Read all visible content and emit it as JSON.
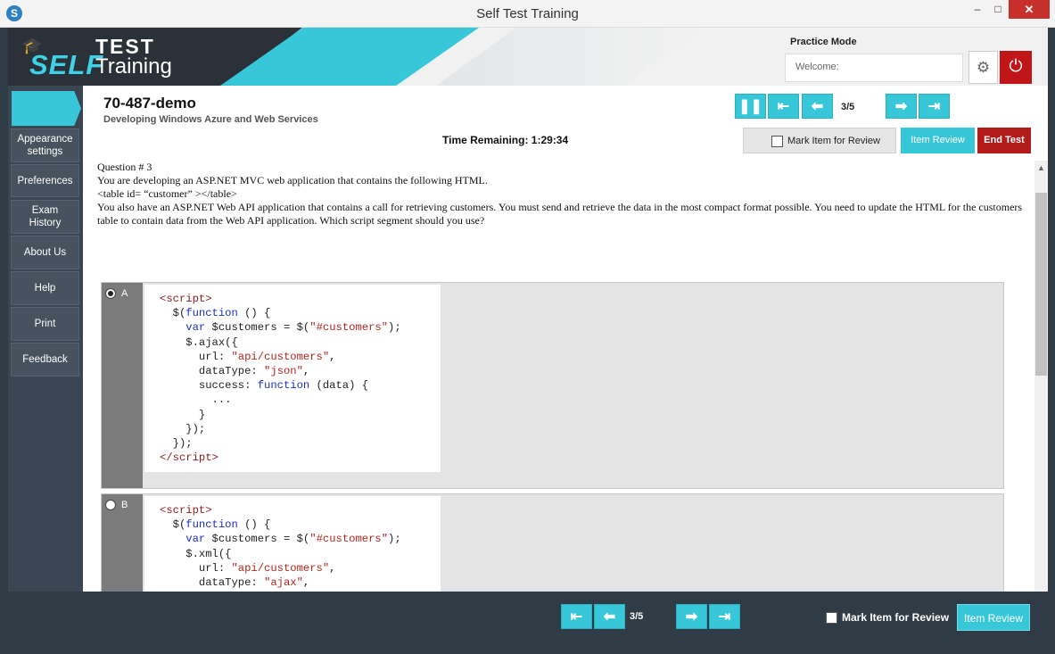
{
  "window": {
    "title": "Self Test Training",
    "minimize": "–",
    "maximize": "□",
    "close": "✕"
  },
  "logo": {
    "self": "SELF",
    "test": "TEST",
    "training": "Training"
  },
  "header": {
    "mode": "Practice Mode",
    "welcome": "Welcome:",
    "gear_icon": "⚙",
    "power_icon": "⏻"
  },
  "sidebar": {
    "items": [
      {
        "label": "Appearance settings"
      },
      {
        "label": "Preferences"
      },
      {
        "label": "Exam History"
      },
      {
        "label": "About Us"
      },
      {
        "label": "Help"
      },
      {
        "label": "Print"
      },
      {
        "label": "Feedback"
      }
    ]
  },
  "exam": {
    "title": "70-487-demo",
    "subtitle": "Developing Windows Azure and Web Services",
    "time_label": "Time Remaining: 1:29:34",
    "progress": "3/5",
    "mark_review": "Mark Item for Review",
    "item_review": "Item Review",
    "end_test": "End Test"
  },
  "nav_icons": {
    "pause": "❚❚",
    "first": "⇤",
    "prev": "⬅",
    "next": "➡",
    "last": "⇥"
  },
  "question": {
    "number": "Question # 3",
    "line1": "You are developing an ASP.NET MVC web application that contains the following HTML.",
    "line2": "<table id= “customer” ></table>",
    "line3": "You also have an ASP.NET Web API application that contains a call for retrieving customers. You must send and retrieve the data in the most compact format possible. You need to update the HTML for the customers table to contain data from the Web API application. Which script segment should you use?"
  },
  "options": [
    {
      "letter": "A",
      "selected": true
    },
    {
      "letter": "B",
      "selected": false
    }
  ],
  "bottom": {
    "progress": "3/5",
    "mark_review": "Mark Item for Review",
    "item_review": "Item Review"
  }
}
